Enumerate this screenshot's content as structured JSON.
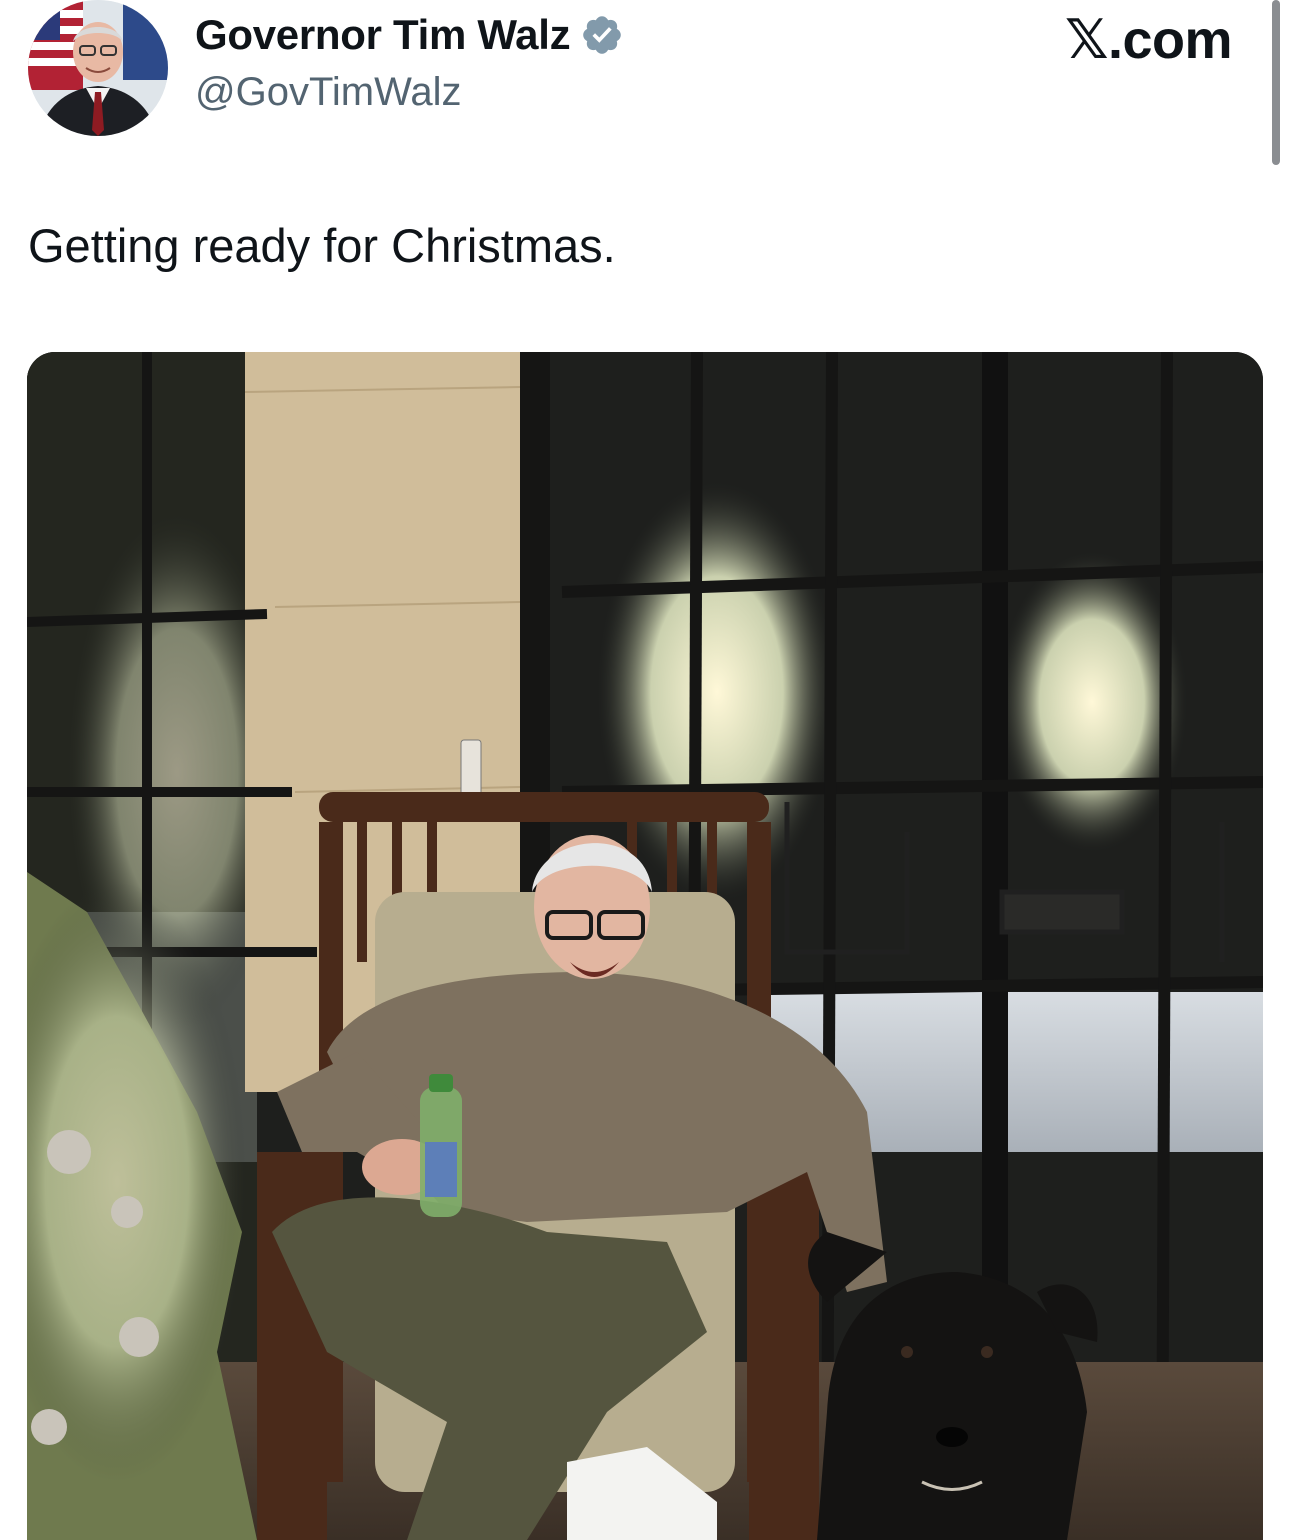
{
  "tweet": {
    "author": {
      "display_name": "Governor Tim Walz",
      "handle": "@GovTimWalz",
      "verified": true,
      "avatar_icon": "profile-photo"
    },
    "brand": "𝕏.com",
    "text": "Getting ready for Christmas.",
    "media": {
      "kind": "photo",
      "icon": "photo-image"
    }
  },
  "colors": {
    "text_primary": "#0f1419",
    "text_secondary": "#536471",
    "verified_badge": "#829aab",
    "background": "#ffffff"
  }
}
